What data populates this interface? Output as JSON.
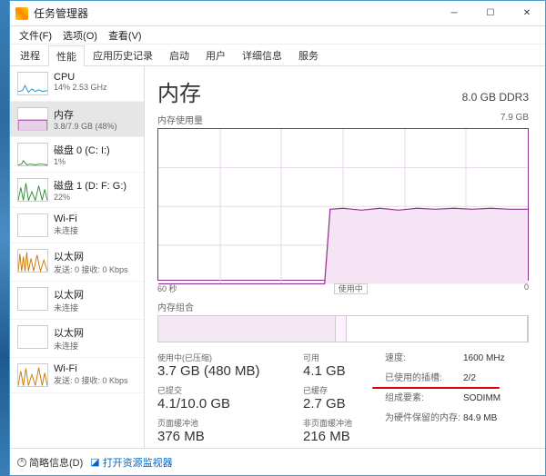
{
  "window": {
    "title": "任务管理器"
  },
  "menu": [
    "文件(F)",
    "选项(O)",
    "查看(V)"
  ],
  "tabs": [
    "进程",
    "性能",
    "应用历史记录",
    "启动",
    "用户",
    "详细信息",
    "服务"
  ],
  "active_tab": 1,
  "sidebar": {
    "selected": 1,
    "items": [
      {
        "label": "CPU",
        "sub": "14% 2.53 GHz",
        "color": "#1e90d4"
      },
      {
        "label": "内存",
        "sub": "3.8/7.9 GB (48%)",
        "color": "#903090"
      },
      {
        "label": "磁盘 0 (C: I:)",
        "sub": "1%",
        "color": "#2e8b2e"
      },
      {
        "label": "磁盘 1 (D: F: G:)",
        "sub": "22%",
        "color": "#2e8b2e"
      },
      {
        "label": "Wi-Fi",
        "sub": "未连接",
        "color": "#cc7700"
      },
      {
        "label": "以太网",
        "sub": "发送: 0 接收: 0 Kbps",
        "color": "#cc7700"
      },
      {
        "label": "以太网",
        "sub": "未连接",
        "color": "#cc7700"
      },
      {
        "label": "以太网",
        "sub": "未连接",
        "color": "#cc7700"
      },
      {
        "label": "Wi-Fi",
        "sub": "发送: 0 接收: 0 Kbps",
        "color": "#cc7700"
      }
    ]
  },
  "header": {
    "title": "内存",
    "right": "8.0 GB DDR3"
  },
  "chart": {
    "label": "内存使用量",
    "max": "7.9 GB",
    "x_left": "60 秒",
    "x_right": "0",
    "marker": "使用中"
  },
  "composition": {
    "label": "内存组合"
  },
  "stats": {
    "usage_k": "使用中(已压缩)",
    "usage_v": "3.7 GB (480 MB)",
    "avail_k": "可用",
    "avail_v": "4.1 GB",
    "commit_k": "已提交",
    "commit_v": "4.1/10.0 GB",
    "cached_k": "已缓存",
    "cached_v": "2.7 GB",
    "paged_k": "页面缓冲池",
    "paged_v": "376 MB",
    "nonpaged_k": "非页面缓冲池",
    "nonpaged_v": "216 MB"
  },
  "right": {
    "speed_k": "速度:",
    "speed_v": "1600 MHz",
    "slots_k": "已使用的插槽:",
    "slots_v": "2/2",
    "form_k": "组成要素:",
    "form_v": "SODIMM",
    "hw_k": "为硬件保留的内存:",
    "hw_v": "84.9 MB"
  },
  "footer": {
    "fewer": "简略信息(D)",
    "link": "打开资源监视器"
  },
  "chart_data": {
    "type": "area",
    "title": "内存使用量",
    "xlabel": "秒",
    "ylabel": "GB",
    "xlim": [
      60,
      0
    ],
    "ylim": [
      0,
      7.9
    ],
    "x": [
      60,
      58,
      56,
      54,
      52,
      50,
      48,
      46,
      44,
      42,
      40,
      38,
      36,
      34,
      32,
      30,
      28,
      26,
      24,
      22,
      20,
      18,
      16,
      14,
      12,
      10,
      8,
      6,
      4,
      2,
      0
    ],
    "values": [
      0,
      0,
      0,
      0,
      0,
      0,
      0,
      0,
      0,
      0,
      0,
      0,
      0,
      0,
      3.8,
      3.8,
      3.8,
      3.8,
      3.78,
      3.82,
      3.79,
      3.82,
      3.78,
      3.8,
      3.78,
      3.78,
      3.8,
      3.8,
      3.8,
      3.78,
      3.79
    ]
  }
}
